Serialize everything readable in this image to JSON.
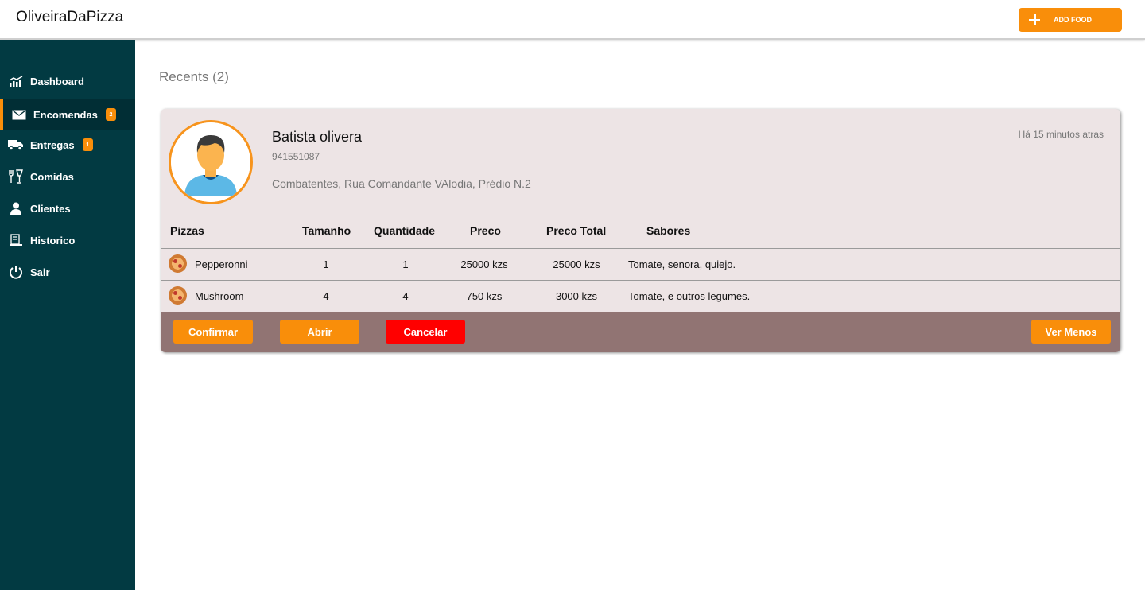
{
  "app": {
    "brand": "OliveiraDaPizza",
    "add_food_label": "ADD FOOD"
  },
  "sidebar": {
    "items": [
      {
        "label": "Dashboard",
        "icon": "chart-icon",
        "badge": null,
        "active": false
      },
      {
        "label": "Encomendas",
        "icon": "mail-icon",
        "badge": "2",
        "active": true
      },
      {
        "label": "Entregas",
        "icon": "truck-icon",
        "badge": "1",
        "active": false
      },
      {
        "label": "Comidas",
        "icon": "cutlery-icon",
        "badge": null,
        "active": false
      },
      {
        "label": "Clientes",
        "icon": "user-icon",
        "badge": null,
        "active": false
      },
      {
        "label": "Historico",
        "icon": "history-icon",
        "badge": null,
        "active": false
      },
      {
        "label": "Sair",
        "icon": "power-icon",
        "badge": null,
        "active": false
      }
    ]
  },
  "main": {
    "section_title": "Recents (2)",
    "order": {
      "customer_name": "Batista olivera",
      "phone": "941551087",
      "address": "Combatentes, Rua Comandante VAlodia, Prédio N.2",
      "time_ago": "Há 15 minutos atras",
      "columns": [
        "Pizzas",
        "Tamanho",
        "Quantidade",
        "Preco",
        "Preco Total",
        "Sabores"
      ],
      "rows": [
        {
          "pizza": "Pepperonni",
          "tamanho": "1",
          "quantidade": "1",
          "preco": "25000 kzs",
          "total": "25000 kzs",
          "sabores": "Tomate, senora, quiejo."
        },
        {
          "pizza": "Mushroom",
          "tamanho": "4",
          "quantidade": "4",
          "preco": "750 kzs",
          "total": "3000 kzs",
          "sabores": "Tomate, e outros legumes."
        }
      ],
      "buttons": {
        "confirm": "Confirmar",
        "open": "Abrir",
        "cancel": "Cancelar",
        "less": "Ver Menos"
      }
    }
  },
  "colors": {
    "accent": "#f98e0a",
    "sidebar": "#023a42",
    "danger": "#ff0000",
    "action_bar": "#917473",
    "card": "#ede4e5"
  }
}
